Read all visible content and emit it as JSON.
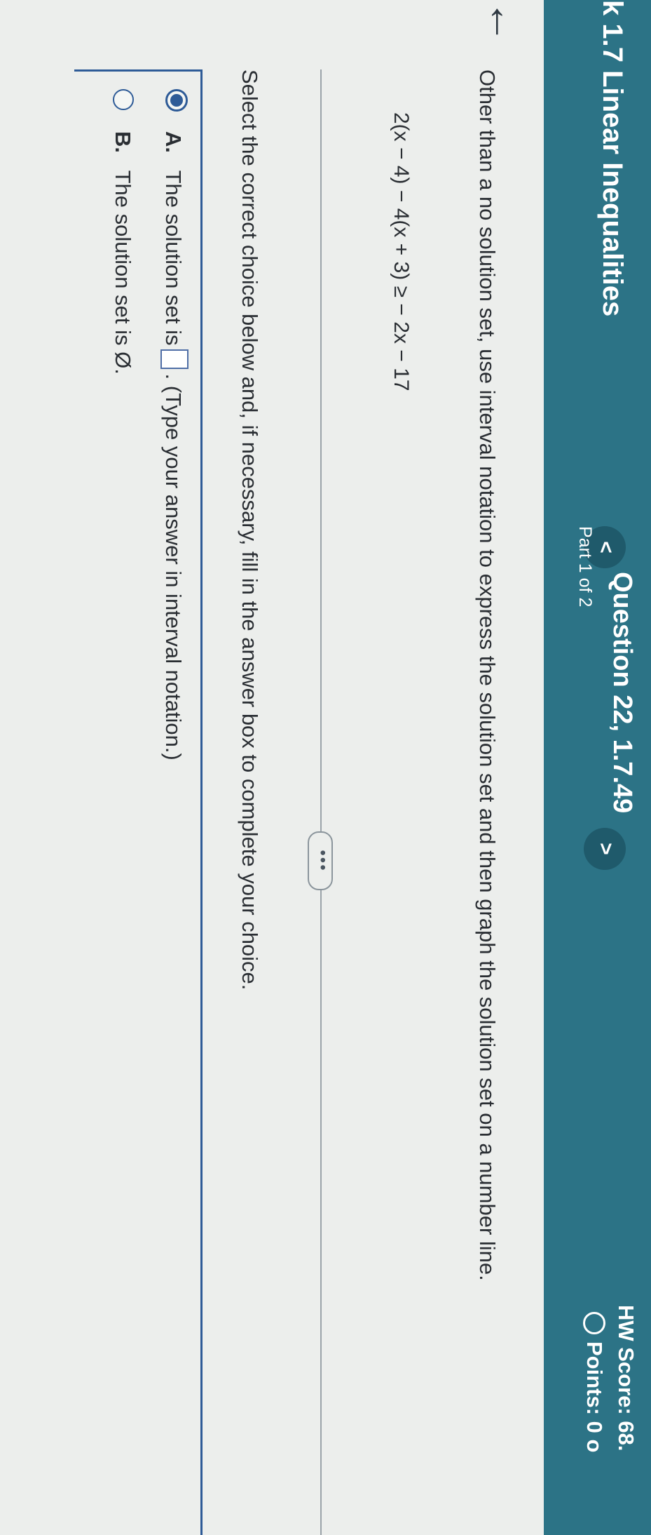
{
  "header": {
    "course_title": "k 1.7 Linear Inequalities",
    "question_title": "Question 22, 1.7.49",
    "question_part": "Part 1 of 2",
    "prev_label": "<",
    "next_label": ">",
    "hw_score": "HW Score: 68.",
    "points": "Points: 0 o"
  },
  "nav": {
    "back_label": "←"
  },
  "question": {
    "instruction": "Other than a no solution set, use interval notation to express the solution set and then graph the solution set on a number line.",
    "inequality": "2(x − 4) − 4(x + 3) ≥ − 2x − 17",
    "more_label": "•••",
    "select_prompt": "Select the correct choice below and, if necessary, fill in the answer box to complete your choice."
  },
  "choices": [
    {
      "letter": "A.",
      "text_before": "The solution set is",
      "text_after": ". (Type your answer in interval notation.)",
      "selected": true
    },
    {
      "letter": "B.",
      "text": "The solution set is Ø.",
      "selected": false
    }
  ],
  "colors": {
    "header": "#2c7386",
    "accent": "#2e5b97",
    "background": "#eceeec"
  }
}
